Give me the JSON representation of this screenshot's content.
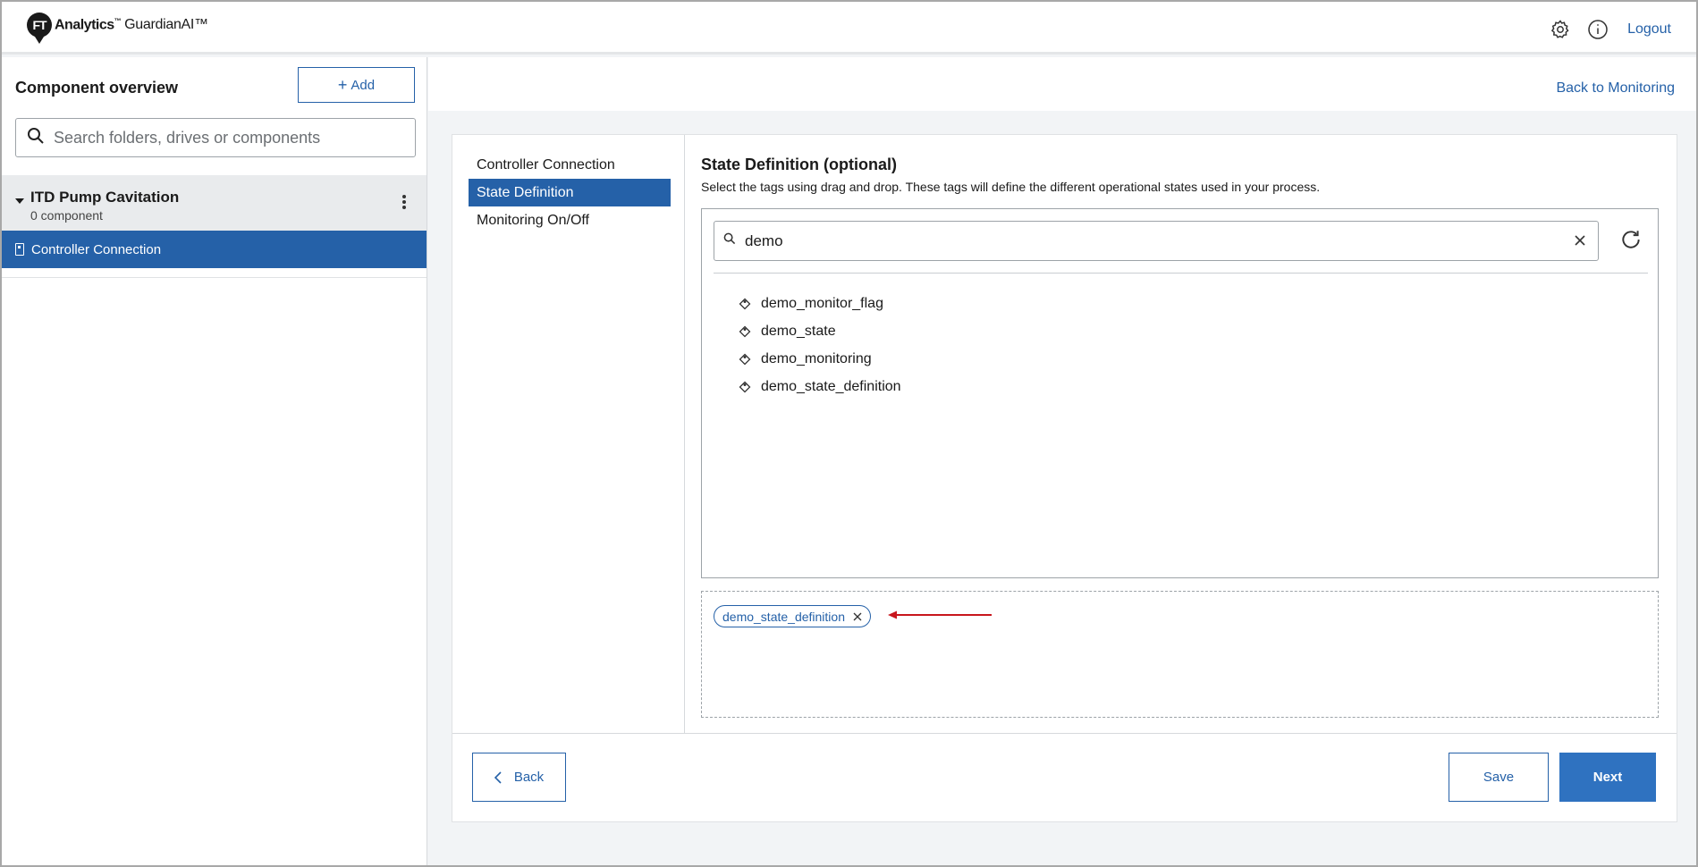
{
  "header": {
    "logo_badge": "FT",
    "logo_brand": "Analytics",
    "logo_brand_tm": "™",
    "logo_product": "GuardianAI™",
    "logout_label": "Logout"
  },
  "sidebar": {
    "title": "Component overview",
    "add_label": "Add",
    "search_placeholder": "Search folders, drives or components",
    "folder": {
      "name": "ITD Pump Cavitation",
      "count": "0 component"
    },
    "selected_component": "Controller Connection"
  },
  "main": {
    "back_to_monitoring": "Back to Monitoring",
    "steps": [
      {
        "label": "Controller Connection",
        "active": false
      },
      {
        "label": "State Definition",
        "active": true
      },
      {
        "label": "Monitoring On/Off",
        "active": false
      }
    ],
    "title": "State Definition (optional)",
    "description": "Select the tags using drag and drop. These tags will define the different operational states used in your process.",
    "tag_search_value": "demo",
    "tags": [
      {
        "label": "demo_monitor_flag"
      },
      {
        "label": "demo_state"
      },
      {
        "label": "demo_monitoring"
      },
      {
        "label": "demo_state_definition"
      }
    ],
    "selected_tags": [
      {
        "label": "demo_state_definition"
      }
    ],
    "back_label": "Back",
    "save_label": "Save",
    "next_label": "Next"
  },
  "colors": {
    "accent": "#2561a8",
    "primary_button": "#2f72c0",
    "annotation_arrow": "#c8161d",
    "background": "#f2f4f6"
  },
  "icons": [
    "gear-icon",
    "info-icon",
    "search-icon",
    "kebab-icon",
    "component-icon",
    "clear-icon",
    "refresh-icon",
    "tag-icon",
    "chip-close-icon",
    "chevron-left-icon",
    "red-arrow"
  ]
}
